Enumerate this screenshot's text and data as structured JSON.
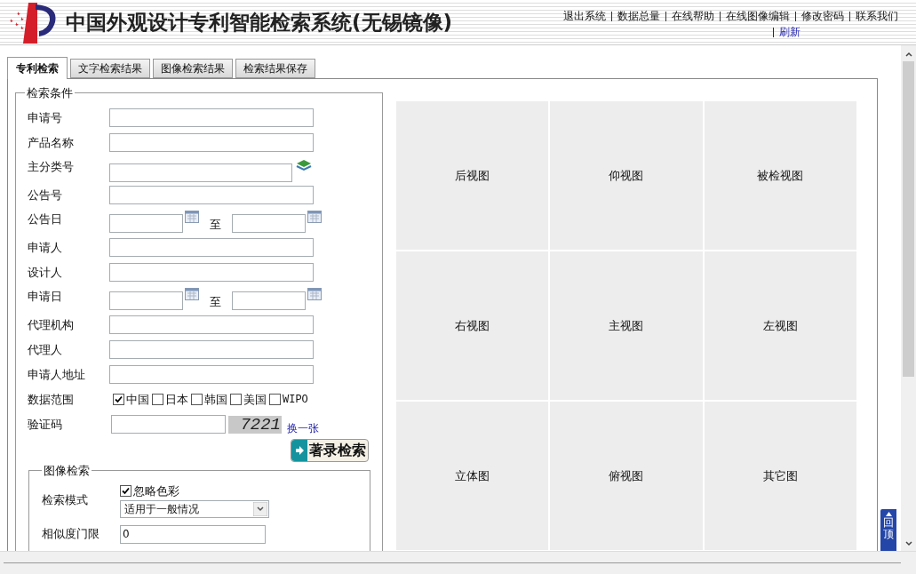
{
  "header": {
    "title": "中国外观设计专利智能检索系统(无锡镜像)",
    "links": [
      "退出系统",
      "数据总量",
      "在线帮助",
      "在线图像编辑",
      "修改密码",
      "联系我们"
    ],
    "refresh": "刷新"
  },
  "tabs": [
    {
      "label": "专利检索",
      "selected": true
    },
    {
      "label": "文字检索结果",
      "selected": false
    },
    {
      "label": "图像检索结果",
      "selected": false
    },
    {
      "label": "检索结果保存",
      "selected": false
    }
  ],
  "criteria": {
    "legend": "检索条件",
    "rows": [
      {
        "kind": "text",
        "label": "申请号"
      },
      {
        "kind": "text",
        "label": "产品名称"
      },
      {
        "kind": "classify",
        "label": "主分类号"
      },
      {
        "kind": "text",
        "label": "公告号"
      },
      {
        "kind": "date_range",
        "label": "公告日",
        "separator": "至"
      },
      {
        "kind": "text",
        "label": "申请人"
      },
      {
        "kind": "text",
        "label": "设计人"
      },
      {
        "kind": "date_range",
        "label": "申请日",
        "separator": "至"
      },
      {
        "kind": "text",
        "label": "代理机构"
      },
      {
        "kind": "text",
        "label": "代理人"
      },
      {
        "kind": "text",
        "label": "申请人地址"
      },
      {
        "kind": "checkboxes",
        "label": "数据范围",
        "options": [
          {
            "label": "中国",
            "checked": true
          },
          {
            "label": "日本",
            "checked": false
          },
          {
            "label": "韩国",
            "checked": false
          },
          {
            "label": "美国",
            "checked": false
          },
          {
            "label": "WIPO",
            "checked": false
          }
        ]
      },
      {
        "kind": "captcha",
        "label": "验证码",
        "code": "7221",
        "refresh": "换一张"
      }
    ],
    "search_button": "著录检索"
  },
  "image_search": {
    "legend": "图像检索",
    "mode_label": "检索模式",
    "ignore_color": {
      "label": "忽略色彩",
      "checked": true
    },
    "mode_value": "适用于一般情况",
    "threshold_label": "相似度门限",
    "threshold_value": "0"
  },
  "views": [
    "后视图",
    "仰视图",
    "被检视图",
    "右视图",
    "主视图",
    "左视图",
    "立体图",
    "俯视图",
    "其它图"
  ],
  "back_to_top": "回顶"
}
